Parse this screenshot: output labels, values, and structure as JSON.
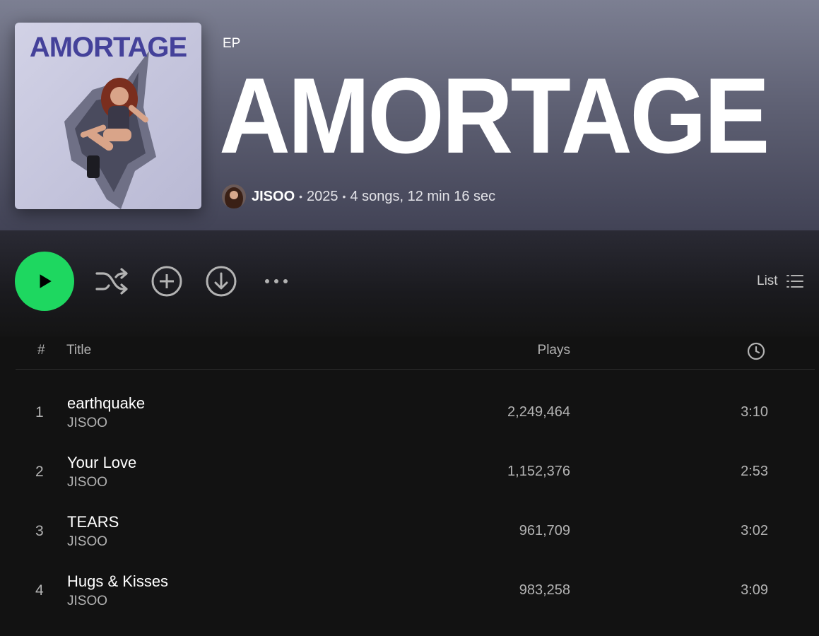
{
  "album": {
    "type": "EP",
    "title": "AMORTAGE",
    "cover_text": "AMORTAGE",
    "artist": "JISOO",
    "year": "2025",
    "summary": "4 songs, 12 min 16 sec",
    "separator": "•"
  },
  "actions": {
    "play_icon": "play-icon",
    "shuffle_icon": "shuffle-icon",
    "add_icon": "add-circle-icon",
    "download_icon": "download-circle-icon",
    "more_icon": "more-dots-icon",
    "view_label": "List"
  },
  "table": {
    "headers": {
      "number": "#",
      "title": "Title",
      "plays": "Plays",
      "duration_icon": "clock-icon"
    },
    "tracks": [
      {
        "number": "1",
        "title": "earthquake",
        "artist": "JISOO",
        "plays": "2,249,464",
        "duration": "3:10"
      },
      {
        "number": "2",
        "title": "Your Love",
        "artist": "JISOO",
        "plays": "1,152,376",
        "duration": "2:53"
      },
      {
        "number": "3",
        "title": "TEARS",
        "artist": "JISOO",
        "plays": "961,709",
        "duration": "3:02"
      },
      {
        "number": "4",
        "title": "Hugs & Kisses",
        "artist": "JISOO",
        "plays": "983,258",
        "duration": "3:09"
      }
    ]
  },
  "colors": {
    "accent": "#1ed760",
    "background": "#121212",
    "header_gradient_top": "#7c7f92",
    "muted_text": "#b3b3b3"
  }
}
